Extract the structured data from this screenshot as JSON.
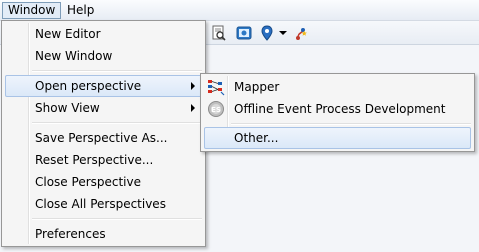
{
  "menubar": {
    "items": [
      "Window",
      "Help"
    ],
    "active": "Window"
  },
  "window_menu": {
    "items": [
      {
        "label": "New Editor"
      },
      {
        "label": "New Window"
      },
      {
        "label": "Open perspective",
        "submenu": true,
        "highlighted": true
      },
      {
        "label": "Show View",
        "submenu": true
      },
      {
        "label": "Save Perspective As..."
      },
      {
        "label": "Reset Perspective..."
      },
      {
        "label": "Close Perspective"
      },
      {
        "label": "Close All Perspectives"
      },
      {
        "label": "Preferences"
      }
    ]
  },
  "perspective_submenu": {
    "items": [
      {
        "label": "Mapper",
        "icon": "mapper-icon"
      },
      {
        "label": "Offline Event Process Development",
        "icon": "event-process-icon"
      },
      {
        "label": "Other...",
        "highlighted": true
      }
    ]
  },
  "colors": {
    "highlight_border": "#a9c3e6",
    "menu_background": "#f5f5f5",
    "mapper_red": "#d62b1f",
    "mapper_blue": "#1e5fb4"
  }
}
